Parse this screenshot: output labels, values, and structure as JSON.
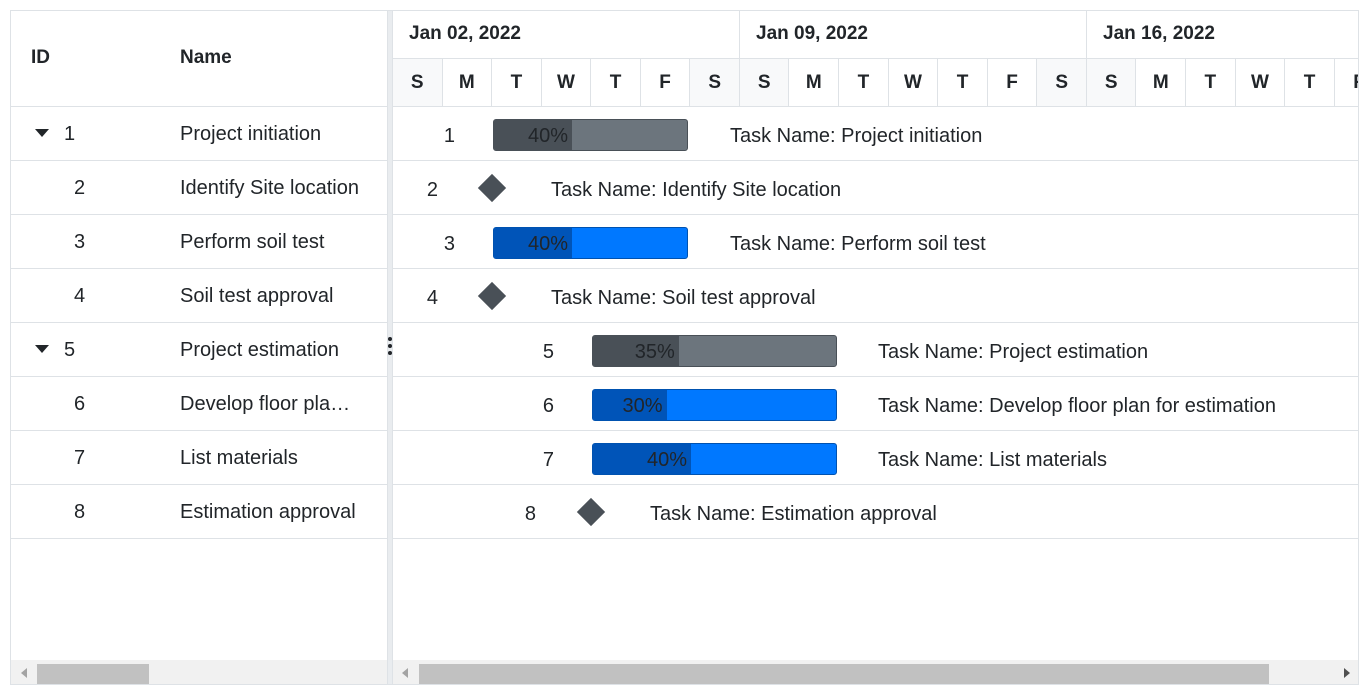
{
  "grid": {
    "columns": {
      "id": "ID",
      "name": "Name"
    },
    "rows": [
      {
        "id": "1",
        "name": "Project initiation",
        "expandable": true
      },
      {
        "id": "2",
        "name": "Identify Site location",
        "expandable": false
      },
      {
        "id": "3",
        "name": "Perform soil test",
        "expandable": false
      },
      {
        "id": "4",
        "name": "Soil test approval",
        "expandable": false
      },
      {
        "id": "5",
        "name": "Project estimation",
        "expandable": true
      },
      {
        "id": "6",
        "name": "Develop floor pla…",
        "expandable": false
      },
      {
        "id": "7",
        "name": "List materials",
        "expandable": false
      },
      {
        "id": "8",
        "name": "Estimation approval",
        "expandable": false
      }
    ]
  },
  "timeline": {
    "weeks": [
      "Jan 02, 2022",
      "Jan 09, 2022",
      "Jan 16, 2022"
    ],
    "days": [
      "S",
      "M",
      "T",
      "W",
      "T",
      "F",
      "S",
      "S",
      "M",
      "T",
      "W",
      "T",
      "F",
      "S",
      "S",
      "M",
      "T",
      "W",
      "T",
      "F"
    ]
  },
  "tasks": [
    {
      "id": "1",
      "type": "parent",
      "progress": 40,
      "progress_label": "40%",
      "label": "Task Name: Project initiation"
    },
    {
      "id": "2",
      "type": "milestone",
      "label": "Task Name: Identify Site location"
    },
    {
      "id": "3",
      "type": "child",
      "progress": 40,
      "progress_label": "40%",
      "label": "Task Name: Perform soil test"
    },
    {
      "id": "4",
      "type": "milestone",
      "label": "Task Name: Soil test approval"
    },
    {
      "id": "5",
      "type": "parent",
      "progress": 35,
      "progress_label": "35%",
      "label": "Task Name: Project estimation"
    },
    {
      "id": "6",
      "type": "child",
      "progress": 30,
      "progress_label": "30%",
      "label": "Task Name: Develop floor plan for estimation"
    },
    {
      "id": "7",
      "type": "child",
      "progress": 40,
      "progress_label": "40%",
      "label": "Task Name: List materials"
    },
    {
      "id": "8",
      "type": "milestone",
      "label": "Task Name: Estimation approval"
    }
  ],
  "colors": {
    "parent_bar": "#6c757d",
    "parent_progress": "#495057",
    "child_bar": "#0078ff",
    "child_progress": "#0054b8",
    "milestone": "#495057"
  }
}
